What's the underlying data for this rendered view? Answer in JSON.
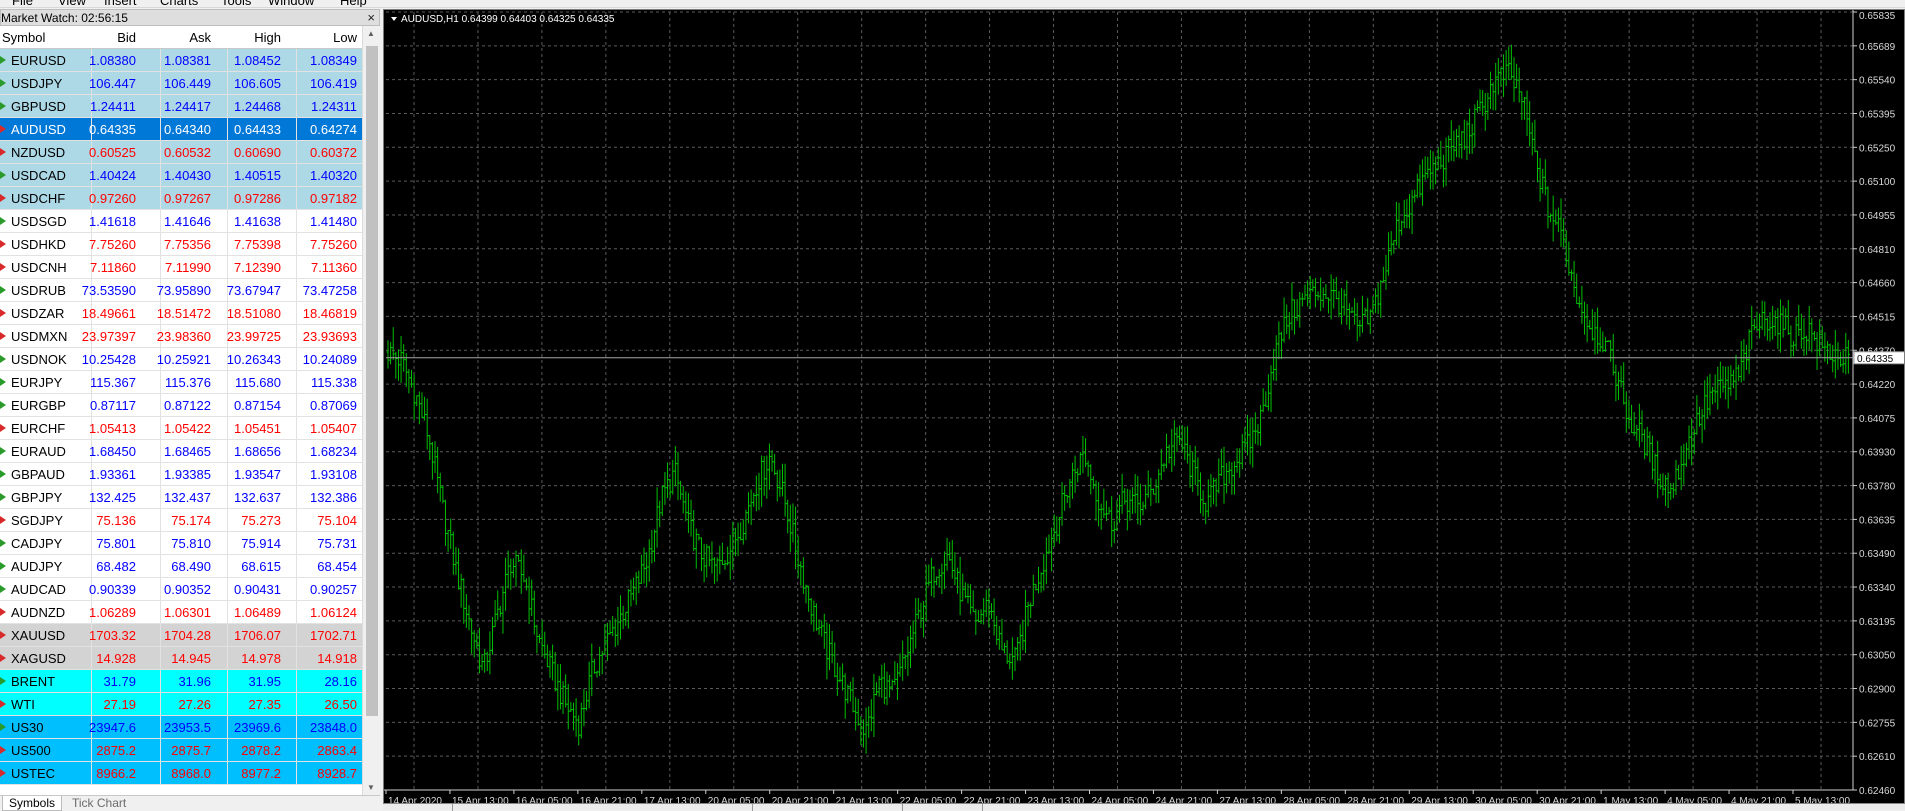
{
  "menu": [
    "File",
    "View",
    "Insert",
    "Charts",
    "Tools",
    "Window",
    "Help"
  ],
  "market_watch": {
    "title": "Market Watch: 02:56:15",
    "close_glyph": "×",
    "columns": [
      "Symbol",
      "Bid",
      "Ask",
      "High",
      "Low"
    ],
    "rows": [
      {
        "symbol": "EURUSD",
        "bid": "1.08380",
        "ask": "1.08381",
        "high": "1.08452",
        "low": "1.08349",
        "dir": "up",
        "bg": "#add8e6",
        "color": "#0000ff"
      },
      {
        "symbol": "USDJPY",
        "bid": "106.447",
        "ask": "106.449",
        "high": "106.605",
        "low": "106.419",
        "dir": "up",
        "bg": "#add8e6",
        "color": "#0000ff"
      },
      {
        "symbol": "GBPUSD",
        "bid": "1.24411",
        "ask": "1.24417",
        "high": "1.24468",
        "low": "1.24311",
        "dir": "up",
        "bg": "#add8e6",
        "color": "#0000ff"
      },
      {
        "symbol": "AUDUSD",
        "bid": "0.64335",
        "ask": "0.64340",
        "high": "0.64433",
        "low": "0.64274",
        "dir": "down",
        "bg": "#0078d7",
        "color": "#ffffff",
        "selected": true
      },
      {
        "symbol": "NZDUSD",
        "bid": "0.60525",
        "ask": "0.60532",
        "high": "0.60690",
        "low": "0.60372",
        "dir": "down",
        "bg": "#add8e6",
        "color": "#ff0000"
      },
      {
        "symbol": "USDCAD",
        "bid": "1.40424",
        "ask": "1.40430",
        "high": "1.40515",
        "low": "1.40320",
        "dir": "up",
        "bg": "#add8e6",
        "color": "#0000ff"
      },
      {
        "symbol": "USDCHF",
        "bid": "0.97260",
        "ask": "0.97267",
        "high": "0.97286",
        "low": "0.97182",
        "dir": "down",
        "bg": "#add8e6",
        "color": "#ff0000"
      },
      {
        "symbol": "USDSGD",
        "bid": "1.41618",
        "ask": "1.41646",
        "high": "1.41638",
        "low": "1.41480",
        "dir": "up",
        "bg": "#ffffff",
        "color": "#0000ff"
      },
      {
        "symbol": "USDHKD",
        "bid": "7.75260",
        "ask": "7.75356",
        "high": "7.75398",
        "low": "7.75260",
        "dir": "down",
        "bg": "#ffffff",
        "color": "#ff0000"
      },
      {
        "symbol": "USDCNH",
        "bid": "7.11860",
        "ask": "7.11990",
        "high": "7.12390",
        "low": "7.11360",
        "dir": "down",
        "bg": "#ffffff",
        "color": "#ff0000"
      },
      {
        "symbol": "USDRUB",
        "bid": "73.53590",
        "ask": "73.95890",
        "high": "73.67947",
        "low": "73.47258",
        "dir": "up",
        "bg": "#ffffff",
        "color": "#0000ff"
      },
      {
        "symbol": "USDZAR",
        "bid": "18.49661",
        "ask": "18.51472",
        "high": "18.51080",
        "low": "18.46819",
        "dir": "down",
        "bg": "#ffffff",
        "color": "#ff0000"
      },
      {
        "symbol": "USDMXN",
        "bid": "23.97397",
        "ask": "23.98360",
        "high": "23.99725",
        "low": "23.93693",
        "dir": "down",
        "bg": "#ffffff",
        "color": "#ff0000"
      },
      {
        "symbol": "USDNOK",
        "bid": "10.25428",
        "ask": "10.25921",
        "high": "10.26343",
        "low": "10.24089",
        "dir": "up",
        "bg": "#ffffff",
        "color": "#0000ff"
      },
      {
        "symbol": "EURJPY",
        "bid": "115.367",
        "ask": "115.376",
        "high": "115.680",
        "low": "115.338",
        "dir": "up",
        "bg": "#ffffff",
        "color": "#0000ff"
      },
      {
        "symbol": "EURGBP",
        "bid": "0.87117",
        "ask": "0.87122",
        "high": "0.87154",
        "low": "0.87069",
        "dir": "up",
        "bg": "#ffffff",
        "color": "#0000ff"
      },
      {
        "symbol": "EURCHF",
        "bid": "1.05413",
        "ask": "1.05422",
        "high": "1.05451",
        "low": "1.05407",
        "dir": "down",
        "bg": "#ffffff",
        "color": "#ff0000"
      },
      {
        "symbol": "EURAUD",
        "bid": "1.68450",
        "ask": "1.68465",
        "high": "1.68656",
        "low": "1.68234",
        "dir": "up",
        "bg": "#ffffff",
        "color": "#0000ff"
      },
      {
        "symbol": "GBPAUD",
        "bid": "1.93361",
        "ask": "1.93385",
        "high": "1.93547",
        "low": "1.93108",
        "dir": "up",
        "bg": "#ffffff",
        "color": "#0000ff"
      },
      {
        "symbol": "GBPJPY",
        "bid": "132.425",
        "ask": "132.437",
        "high": "132.637",
        "low": "132.386",
        "dir": "up",
        "bg": "#ffffff",
        "color": "#0000ff"
      },
      {
        "symbol": "SGDJPY",
        "bid": "75.136",
        "ask": "75.174",
        "high": "75.273",
        "low": "75.104",
        "dir": "down",
        "bg": "#ffffff",
        "color": "#ff0000"
      },
      {
        "symbol": "CADJPY",
        "bid": "75.801",
        "ask": "75.810",
        "high": "75.914",
        "low": "75.731",
        "dir": "up",
        "bg": "#ffffff",
        "color": "#0000ff"
      },
      {
        "symbol": "AUDJPY",
        "bid": "68.482",
        "ask": "68.490",
        "high": "68.615",
        "low": "68.454",
        "dir": "up",
        "bg": "#ffffff",
        "color": "#0000ff"
      },
      {
        "symbol": "AUDCAD",
        "bid": "0.90339",
        "ask": "0.90352",
        "high": "0.90431",
        "low": "0.90257",
        "dir": "up",
        "bg": "#ffffff",
        "color": "#0000ff"
      },
      {
        "symbol": "AUDNZD",
        "bid": "1.06289",
        "ask": "1.06301",
        "high": "1.06489",
        "low": "1.06124",
        "dir": "down",
        "bg": "#ffffff",
        "color": "#ff0000"
      },
      {
        "symbol": "XAUUSD",
        "bid": "1703.32",
        "ask": "1704.28",
        "high": "1706.07",
        "low": "1702.71",
        "dir": "down",
        "bg": "#d3d3d3",
        "color": "#ff0000"
      },
      {
        "symbol": "XAGUSD",
        "bid": "14.928",
        "ask": "14.945",
        "high": "14.978",
        "low": "14.918",
        "dir": "down",
        "bg": "#d3d3d3",
        "color": "#ff0000"
      },
      {
        "symbol": "BRENT",
        "bid": "31.79",
        "ask": "31.96",
        "high": "31.95",
        "low": "28.16",
        "dir": "up",
        "bg": "#00ffff",
        "color": "#0000ff"
      },
      {
        "symbol": "WTI",
        "bid": "27.19",
        "ask": "27.26",
        "high": "27.35",
        "low": "26.50",
        "dir": "down",
        "bg": "#00ffff",
        "color": "#ff0000"
      },
      {
        "symbol": "US30",
        "bid": "23947.6",
        "ask": "23953.5",
        "high": "23969.6",
        "low": "23848.0",
        "dir": "up",
        "bg": "#00bfff",
        "color": "#0000ff"
      },
      {
        "symbol": "US500",
        "bid": "2875.2",
        "ask": "2875.7",
        "high": "2878.2",
        "low": "2863.4",
        "dir": "down",
        "bg": "#00bfff",
        "color": "#ff0000"
      },
      {
        "symbol": "USTEC",
        "bid": "8966.2",
        "ask": "8968.0",
        "high": "8977.2",
        "low": "8928.7",
        "dir": "down",
        "bg": "#00bfff",
        "color": "#ff0000"
      }
    ],
    "tabs": [
      "Symbols",
      "Tick Chart"
    ]
  },
  "chart_data": {
    "type": "bar",
    "title": "AUDUSD,H1  0.64399 0.64403 0.64325 0.64335",
    "symbol": "AUDUSD",
    "timeframe": "H1",
    "ohlc_header": [
      "0.64399",
      "0.64403",
      "0.64325",
      "0.64335"
    ],
    "current_price": 0.64335,
    "current_price_label": "0.64335",
    "ylim": [
      0.6246,
      0.65835
    ],
    "y_ticks": [
      "0.65835",
      "0.65689",
      "0.65540",
      "0.65395",
      "0.65250",
      "0.65100",
      "0.64955",
      "0.64810",
      "0.64660",
      "0.64515",
      "0.64370",
      "0.64220",
      "0.64075",
      "0.63930",
      "0.63780",
      "0.63635",
      "0.63490",
      "0.63340",
      "0.63195",
      "0.63050",
      "0.62900",
      "0.62755",
      "0.62610",
      "0.62460"
    ],
    "x_ticks": [
      "14 Apr 2020",
      "15 Apr 13:00",
      "16 Apr 05:00",
      "16 Apr 21:00",
      "17 Apr 13:00",
      "20 Apr 05:00",
      "20 Apr 21:00",
      "21 Apr 13:00",
      "22 Apr 05:00",
      "22 Apr 21:00",
      "23 Apr 13:00",
      "24 Apr 05:00",
      "24 Apr 21:00",
      "27 Apr 13:00",
      "28 Apr 05:00",
      "28 Apr 21:00",
      "29 Apr 13:00",
      "30 Apr 05:00",
      "30 Apr 21:00",
      "1 May 13:00",
      "4 May 05:00",
      "4 May 21:00",
      "5 May 13:00"
    ],
    "closes": [
      0.6436,
      0.6432,
      0.6418,
      0.6399,
      0.6368,
      0.6341,
      0.6318,
      0.6298,
      0.6322,
      0.6345,
      0.6338,
      0.6312,
      0.6297,
      0.6283,
      0.6275,
      0.6298,
      0.631,
      0.6321,
      0.6332,
      0.6346,
      0.6372,
      0.6384,
      0.6361,
      0.6348,
      0.6342,
      0.635,
      0.6362,
      0.6379,
      0.6391,
      0.6373,
      0.6348,
      0.6326,
      0.6309,
      0.6296,
      0.6283,
      0.6271,
      0.6293,
      0.6288,
      0.6305,
      0.6324,
      0.6341,
      0.6348,
      0.6331,
      0.6318,
      0.6327,
      0.6306,
      0.6302,
      0.6328,
      0.6345,
      0.6362,
      0.6381,
      0.6392,
      0.6373,
      0.6362,
      0.6372,
      0.6369,
      0.6376,
      0.6392,
      0.6398,
      0.6383,
      0.637,
      0.6381,
      0.6388,
      0.6395,
      0.6408,
      0.6436,
      0.6452,
      0.6458,
      0.6462,
      0.6461,
      0.6456,
      0.6446,
      0.6451,
      0.647,
      0.6492,
      0.6501,
      0.6512,
      0.6518,
      0.6525,
      0.653,
      0.654,
      0.6553,
      0.6557,
      0.6548,
      0.6521,
      0.6498,
      0.6487,
      0.6462,
      0.6448,
      0.6441,
      0.6426,
      0.6405,
      0.6398,
      0.6384,
      0.6376,
      0.6392,
      0.6407,
      0.6418,
      0.6421,
      0.6426,
      0.6445,
      0.6451,
      0.6448,
      0.6443,
      0.6446,
      0.6438,
      0.6435,
      0.6432
    ]
  }
}
